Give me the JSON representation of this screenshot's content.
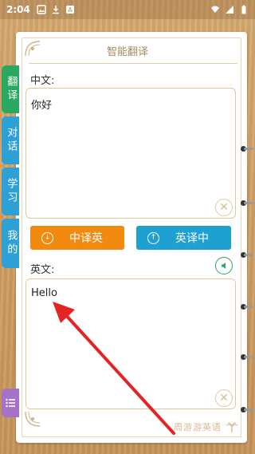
{
  "status_bar": {
    "time": "2:04",
    "left_icons": [
      "gallery-icon",
      "download-icon",
      "translate-app-icon"
    ],
    "right_icons": [
      "wifi-icon",
      "signal-icon",
      "battery-icon"
    ]
  },
  "header": {
    "title": "智能翻译"
  },
  "side_tabs": [
    {
      "label": "翻译",
      "color": "#2aa860",
      "active": true
    },
    {
      "label": "对话",
      "color": "#2ea0d6",
      "active": false
    },
    {
      "label": "学习",
      "color": "#2ea0d6",
      "active": false
    },
    {
      "label": "我的",
      "color": "#2ea0d6",
      "active": false
    }
  ],
  "source": {
    "label": "中文:",
    "text": "你好"
  },
  "actions": {
    "zh_to_en": {
      "label": "中译英",
      "color": "#f28a10"
    },
    "en_to_zh": {
      "label": "英译中",
      "color": "#1ea0d0"
    }
  },
  "target": {
    "label": "英文:",
    "text": "Hello"
  },
  "menu_icon": "list-icon",
  "footer": {
    "brand": "周游游英语"
  },
  "colors": {
    "accent_green": "#2aa860",
    "accent_blue": "#1ea0d0",
    "accent_orange": "#f28a10",
    "annotation_arrow": "#e42424"
  }
}
